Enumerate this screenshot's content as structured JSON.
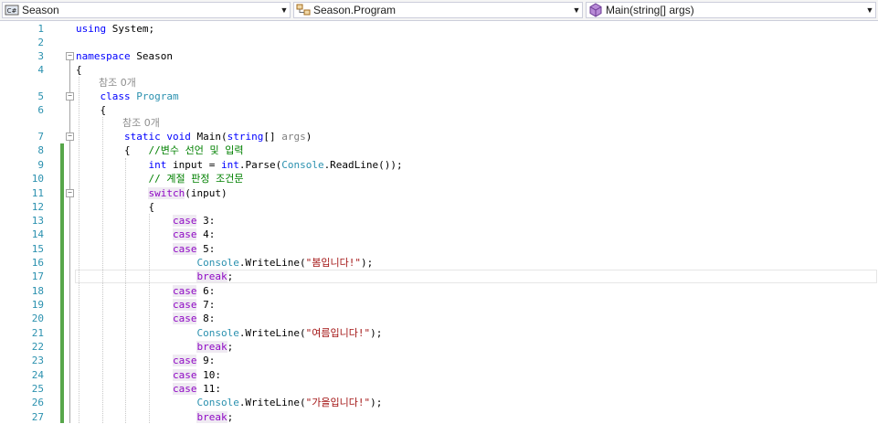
{
  "navbar": {
    "project": "Season",
    "type": "Season.Program",
    "member": "Main(string[] args)"
  },
  "lens": {
    "class_refs": "참조 0개",
    "main_refs": "참조 0개"
  },
  "line_numbers": [
    "1",
    "2",
    "3",
    "4",
    "5",
    "6",
    "7",
    "8",
    "9",
    "10",
    "11",
    "12",
    "13",
    "14",
    "15",
    "16",
    "17",
    "18",
    "19",
    "20",
    "21",
    "22",
    "23",
    "24",
    "25",
    "26",
    "27"
  ],
  "code": {
    "l1_kw": "using",
    "l1_rest": " System;",
    "l3_kw": "namespace",
    "l3_rest": " Season",
    "l4": "{",
    "l5_kw": "class",
    "l5_type": "Program",
    "l6": "{",
    "l7_kw1": "static",
    "l7_kw2": "void",
    "l7_name": " Main(",
    "l7_kw3": "string",
    "l7_brackets": "[] ",
    "l7_args": "args",
    "l7_close": ")",
    "l8_brace": "{   ",
    "l8_cmt": "//변수 선언 및 입력",
    "l9_kw": "int",
    "l9_a": " input = ",
    "l9_kw2": "int",
    "l9_b": ".Parse(",
    "l9_type": "Console",
    "l9_c": ".ReadLine());",
    "l10_cmt": "// 계절 판정 조건문",
    "l11_kw": "switch",
    "l11_rest": "(input)",
    "l12": "{",
    "l13_kw": "case",
    "l13_rest": " 3:",
    "l14_kw": "case",
    "l14_rest": " 4:",
    "l15_kw": "case",
    "l15_rest": " 5:",
    "l16_type": "Console",
    "l16_a": ".WriteLine(",
    "l16_str": "\"봄입니다!\"",
    "l16_b": ");",
    "l17_kw": "break",
    "l17_rest": ";",
    "l18_kw": "case",
    "l18_rest": " 6:",
    "l19_kw": "case",
    "l19_rest": " 7:",
    "l20_kw": "case",
    "l20_rest": " 8:",
    "l21_type": "Console",
    "l21_a": ".WriteLine(",
    "l21_str": "\"여름입니다!\"",
    "l21_b": ");",
    "l22_kw": "break",
    "l22_rest": ";",
    "l23_kw": "case",
    "l23_rest": " 9:",
    "l24_kw": "case",
    "l24_rest": " 10:",
    "l25_kw": "case",
    "l25_rest": " 11:",
    "l26_type": "Console",
    "l26_a": ".WriteLine(",
    "l26_str": "\"가을입니다!\"",
    "l26_b": ");",
    "l27_kw": "break",
    "l27_rest": ";"
  },
  "colors": {
    "keyword": "#0000ff",
    "control_keyword": "#8f08c4",
    "type": "#2b91af",
    "string": "#a31515",
    "comment": "#008000",
    "line_number": "#2b91af",
    "change_bar": "#57a64a"
  }
}
